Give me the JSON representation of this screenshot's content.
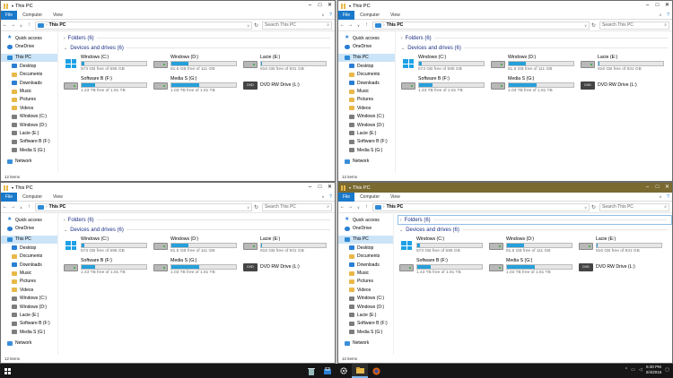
{
  "windows": [
    {
      "title": "This PC"
    },
    {
      "title": "This PC"
    },
    {
      "title": "This PC"
    },
    {
      "title": "This PC"
    }
  ],
  "ribbon": {
    "file": "File",
    "computer": "Computer",
    "view": "View"
  },
  "address": {
    "path": "This PC",
    "search_placeholder": "Search This PC"
  },
  "nav": {
    "quick_access": "Quick access",
    "onedrive": "OneDrive",
    "this_pc": "This PC",
    "desktop": "Desktop",
    "documents": "Documents",
    "downloads": "Downloads",
    "music": "Music",
    "pictures": "Pictures",
    "videos": "Videos",
    "windows_c": "Windows (C:)",
    "windows_d": "Windows (D:)",
    "lacie_e": "Lacie (E:)",
    "software_f": "Software B (F:)",
    "media_g": "Media S (G:)",
    "network": "Network"
  },
  "groups": {
    "folders": "Folders (6)",
    "devices": "Devices and drives (6)"
  },
  "drives": [
    {
      "name": "Windows (C:)",
      "free": "573 GB free of 595 GB",
      "used_fraction": 0.04,
      "icon": "windows-drive-icon"
    },
    {
      "name": "Windows (D:)",
      "free": "81.6 GB free of 111 GB",
      "used_fraction": 0.26,
      "icon": "hard-drive-icon"
    },
    {
      "name": "Lacie (E:)",
      "free": "916 GB free of 931 GB",
      "used_fraction": 0.02,
      "icon": "hard-drive-icon"
    },
    {
      "name": "Software B (F:)",
      "free": "1.43 TB free of 1.81 TB",
      "used_fraction": 0.21,
      "icon": "hard-drive-icon"
    },
    {
      "name": "Media S (G:)",
      "free": "1.03 TB free of 1.81 TB",
      "used_fraction": 0.43,
      "icon": "hard-drive-icon"
    },
    {
      "name": "DVD RW Drive (L:)",
      "free": "",
      "used_fraction": null,
      "icon": "dvd-drive-icon"
    }
  ],
  "status": {
    "items": "12 items"
  },
  "taskbar": {
    "time": "6:30 PM",
    "date": "2/4/2016"
  },
  "colors": {
    "accent": "#1979ca",
    "bar_fill": "#26a0da",
    "active_title": "#7a6a30"
  }
}
